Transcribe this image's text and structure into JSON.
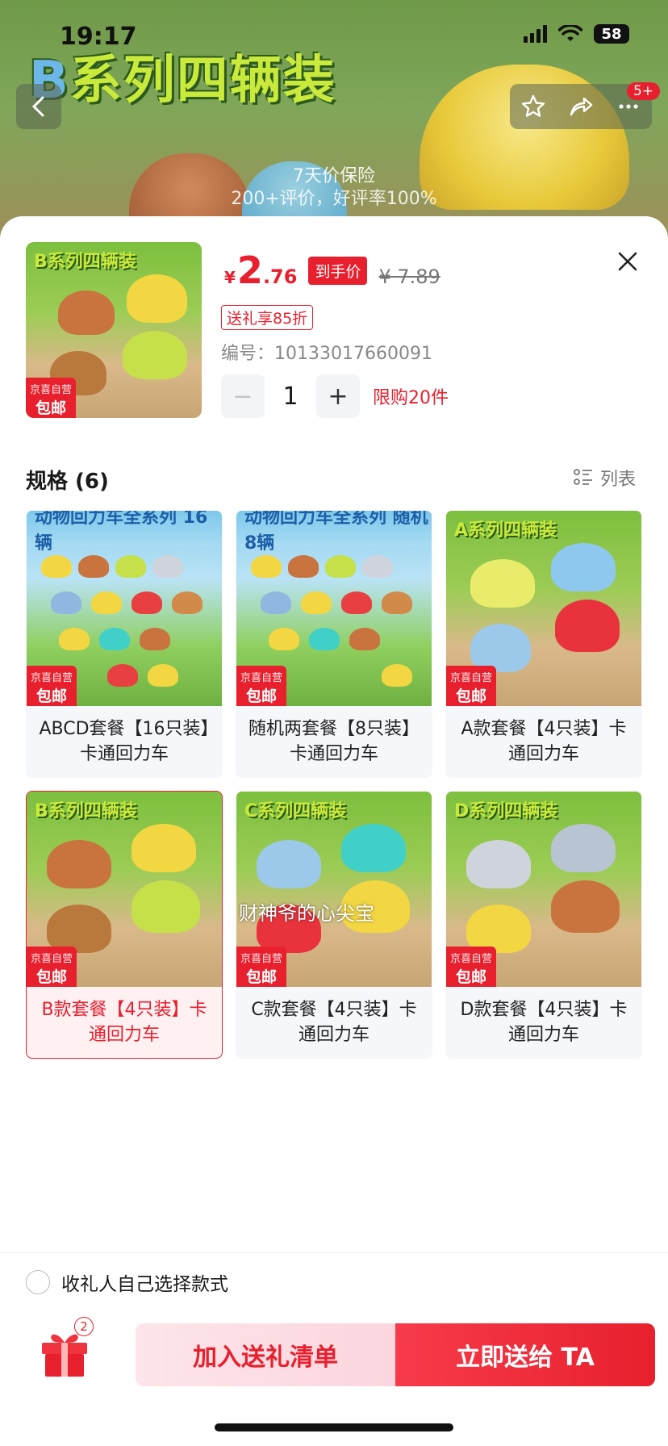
{
  "status_bar": {
    "time": "19:17",
    "battery": "58"
  },
  "background": {
    "banner_title_b": "B",
    "banner_title_rest": "系列四辆装",
    "guarantee": "7天价保险",
    "rating": "200+评价，好评率100%",
    "nav_badge": "5+"
  },
  "sheet": {
    "price": {
      "symbol": "¥",
      "integer": "2",
      "decimal": ".76",
      "tag": "到手价",
      "original": "¥ 7.89"
    },
    "gift_discount": "送礼享85折",
    "sku_code": "编号：10133017660091",
    "quantity": {
      "minus": "−",
      "value": "1",
      "plus": "+",
      "limit": "限购20件"
    },
    "spec_title": "规格 (6)",
    "list_view_label": "列表",
    "thumb": {
      "title": "B系列四辆装",
      "badge_top": "京喜自营",
      "badge_bottom": "包邮"
    },
    "variants": [
      {
        "label": "ABCD套餐【16只装】卡通回力车",
        "img_title": "动物回力车全系列 16辆",
        "selected": false
      },
      {
        "label": "随机两套餐【8只装】卡通回力车",
        "img_title": "动物回力车全系列 随机8辆",
        "selected": false
      },
      {
        "label": "A款套餐【4只装】卡通回力车",
        "img_title": "A系列四辆装",
        "selected": false
      },
      {
        "label": "B款套餐【4只装】卡通回力车",
        "img_title": "B系列四辆装",
        "selected": true
      },
      {
        "label": "C款套餐【4只装】卡通回力车",
        "img_title": "C系列四辆装",
        "selected": false
      },
      {
        "label": "D款套餐【4只装】卡通回力车",
        "img_title": "D系列四辆装",
        "selected": false
      }
    ],
    "ship_badge": {
      "top": "京喜自营",
      "bottom": "包邮"
    },
    "watermark": "财神爷的心尖宝"
  },
  "footer": {
    "receiver_choose": "收礼人自己选择款式",
    "gift_count": "2",
    "add_button": "加入送礼清单",
    "send_button": "立即送给 TA"
  },
  "colors": {
    "accent": "#e8202e",
    "selected_bg": "#fff0f2"
  }
}
